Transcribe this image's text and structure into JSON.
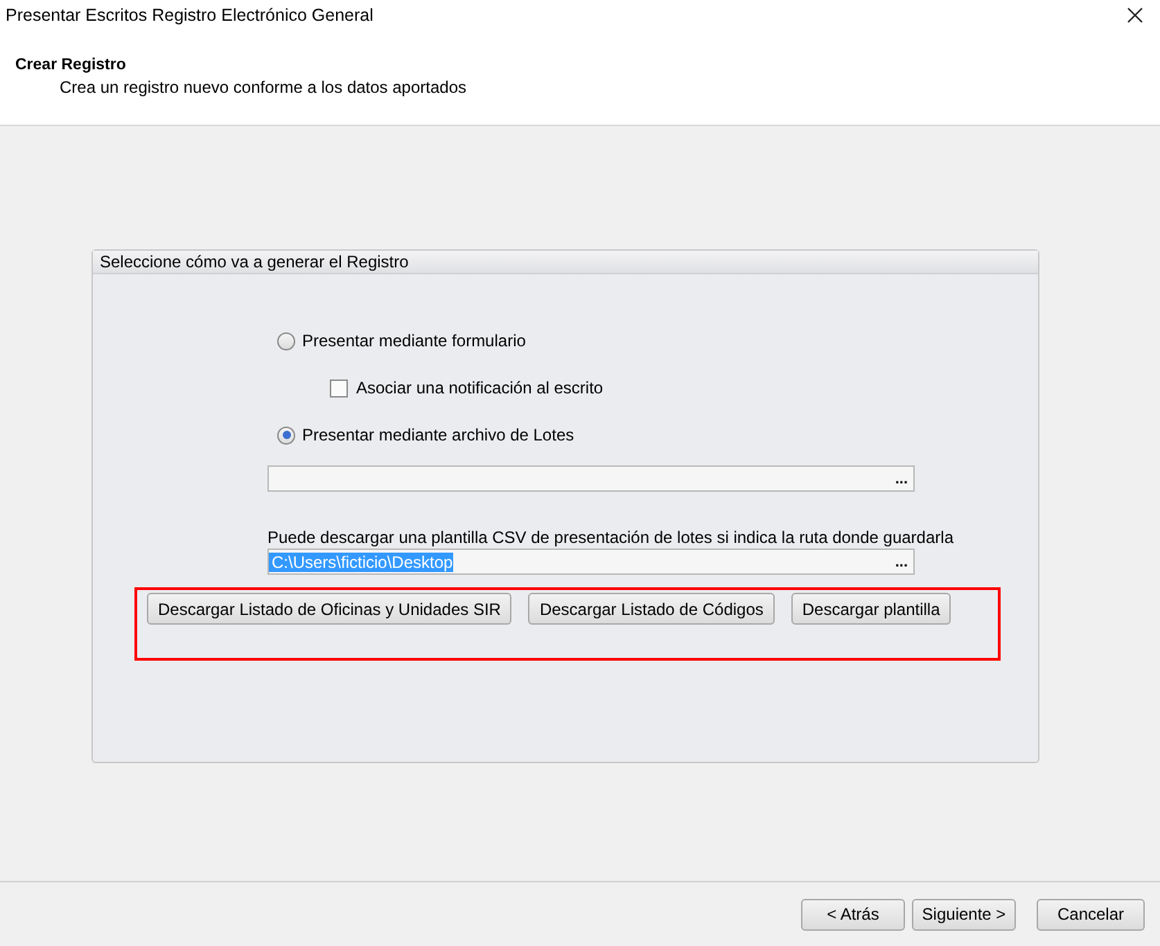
{
  "window": {
    "title": "Presentar Escritos Registro Electrónico General"
  },
  "header": {
    "title": "Crear Registro",
    "subtitle": "Crea un registro nuevo conforme a los datos aportados"
  },
  "group": {
    "title": "Seleccione cómo va a generar el Registro",
    "options": [
      {
        "kind": "radio",
        "label": "Presentar mediante formulario",
        "selected": false
      },
      {
        "kind": "checkbox",
        "label": "Asociar una notificación al escrito",
        "checked": false
      },
      {
        "kind": "radio",
        "label": "Presentar mediante archivo de Lotes",
        "selected": true
      }
    ],
    "batch_field": {
      "browse": "..."
    },
    "template_hint": "Puede descargar una plantilla CSV de presentación de lotes si indica la ruta donde guardarla",
    "path_field": {
      "value": "C:\\Users\\ficticio\\Desktop",
      "value_selected": true,
      "browse": "..."
    },
    "download_buttons": [
      "Descargar Listado de Oficinas y Unidades SIR",
      "Descargar Listado de Códigos",
      "Descargar plantilla"
    ]
  },
  "footer_buttons": [
    "< Atrás",
    "Siguiente >",
    "Cancelar"
  ]
}
